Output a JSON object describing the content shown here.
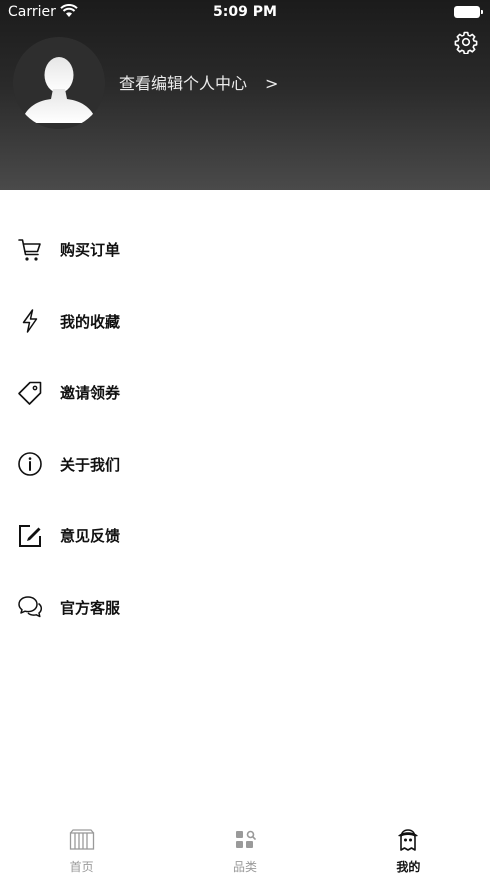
{
  "status_bar": {
    "carrier": "Carrier",
    "time": "5:09 PM"
  },
  "header": {
    "profile_link": "查看编辑个人中心",
    "arrow": ">"
  },
  "menu": {
    "items": [
      {
        "label": "购买订单",
        "icon": "cart-icon"
      },
      {
        "label": "我的收藏",
        "icon": "lightning-icon"
      },
      {
        "label": "邀请领券",
        "icon": "tag-icon"
      },
      {
        "label": "关于我们",
        "icon": "info-icon"
      },
      {
        "label": "意见反馈",
        "icon": "edit-icon"
      },
      {
        "label": "官方客服",
        "icon": "chat-icon"
      }
    ]
  },
  "tabbar": {
    "tabs": [
      {
        "label": "首页",
        "icon": "home-icon",
        "active": false
      },
      {
        "label": "品类",
        "icon": "category-icon",
        "active": false
      },
      {
        "label": "我的",
        "icon": "profile-icon",
        "active": true
      }
    ]
  },
  "colors": {
    "header_top": "#1b1b1b",
    "header_bottom": "#4a4a4a",
    "text_primary": "#111111",
    "tab_inactive": "#9a9a9a"
  }
}
